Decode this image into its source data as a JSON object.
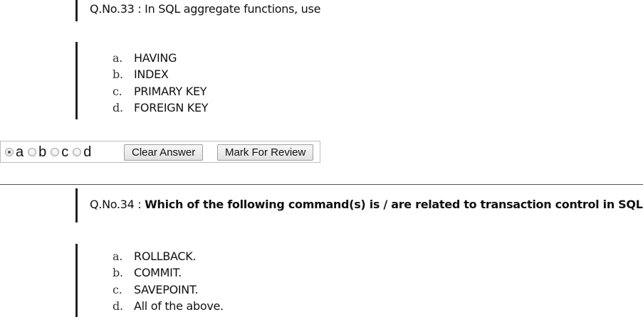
{
  "questions": [
    {
      "number": "Q.No.33 : ",
      "text": "In SQL aggregate functions, use",
      "options": [
        {
          "letter": "a.",
          "text": "HAVING"
        },
        {
          "letter": "b.",
          "text": "INDEX"
        },
        {
          "letter": "c.",
          "text": "PRIMARY KEY"
        },
        {
          "letter": "d.",
          "text": "FOREIGN KEY"
        }
      ]
    },
    {
      "number": "Q.No.34  : ",
      "text": "Which of the following command(s) is / are related to transaction control in SQL?",
      "options": [
        {
          "letter": "a.",
          "text": "ROLLBACK."
        },
        {
          "letter": "b.",
          "text": "COMMIT."
        },
        {
          "letter": "c.",
          "text": "SAVEPOINT."
        },
        {
          "letter": "d.",
          "text": "All of the above."
        }
      ]
    }
  ],
  "answer_bar": {
    "radios": [
      {
        "label": "a",
        "checked": true
      },
      {
        "label": "b",
        "checked": false
      },
      {
        "label": "c",
        "checked": false
      },
      {
        "label": "d",
        "checked": false
      }
    ],
    "clear_label": "Clear Answer",
    "review_label": "Mark For Review"
  }
}
